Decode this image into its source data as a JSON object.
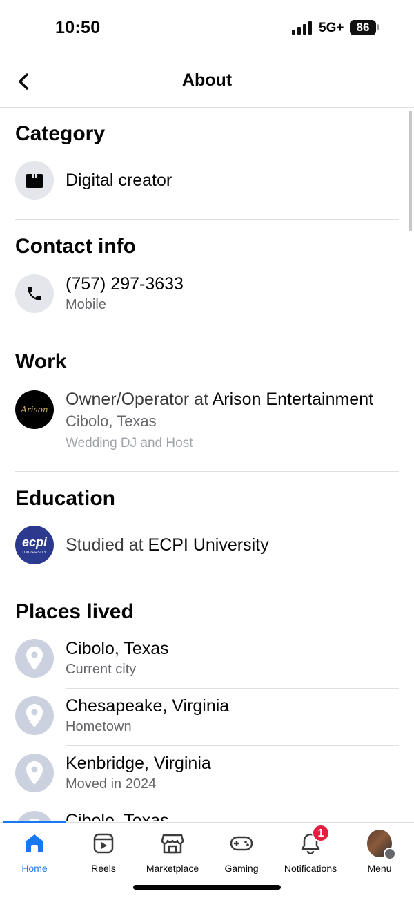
{
  "status_bar": {
    "time": "10:50",
    "network": "5G+",
    "battery": "86"
  },
  "nav": {
    "title": "About",
    "back_icon": "chevron-left-icon"
  },
  "category": {
    "title": "Category",
    "value": "Digital creator",
    "icon": "briefcase-icon"
  },
  "contact": {
    "title": "Contact info",
    "phone": "(757) 297-3633",
    "phone_type": "Mobile",
    "icon": "phone-icon"
  },
  "work": {
    "title": "Work",
    "role_prefix": "Owner/Operator at ",
    "company": "Arison Entertainment",
    "location": "Cibolo, Texas",
    "description": "Wedding DJ and Host",
    "logo_text": "Arison"
  },
  "education": {
    "title": "Education",
    "prefix": "Studied at ",
    "school": "ECPI University",
    "logo_text": "ecpi",
    "logo_subtext": "UNIVERSITY"
  },
  "places": {
    "title": "Places lived",
    "items": [
      {
        "name": "Cibolo, Texas",
        "detail": "Current city"
      },
      {
        "name": "Chesapeake, Virginia",
        "detail": "Hometown"
      },
      {
        "name": "Kenbridge, Virginia",
        "detail": "Moved in 2024"
      },
      {
        "name": "Cibolo, Texas",
        "detail": ""
      }
    ]
  },
  "tabs": [
    {
      "label": "Home",
      "icon": "home-icon",
      "active": true
    },
    {
      "label": "Reels",
      "icon": "reels-icon",
      "active": false
    },
    {
      "label": "Marketplace",
      "icon": "marketplace-icon",
      "active": false
    },
    {
      "label": "Gaming",
      "icon": "gaming-icon",
      "active": false
    },
    {
      "label": "Notifications",
      "icon": "bell-icon",
      "active": false,
      "badge": "1"
    },
    {
      "label": "Menu",
      "icon": "menu-avatar",
      "active": false
    }
  ],
  "colors": {
    "accent": "#1877f2",
    "badge": "#e41e3f",
    "secondary_text": "#65676b"
  }
}
